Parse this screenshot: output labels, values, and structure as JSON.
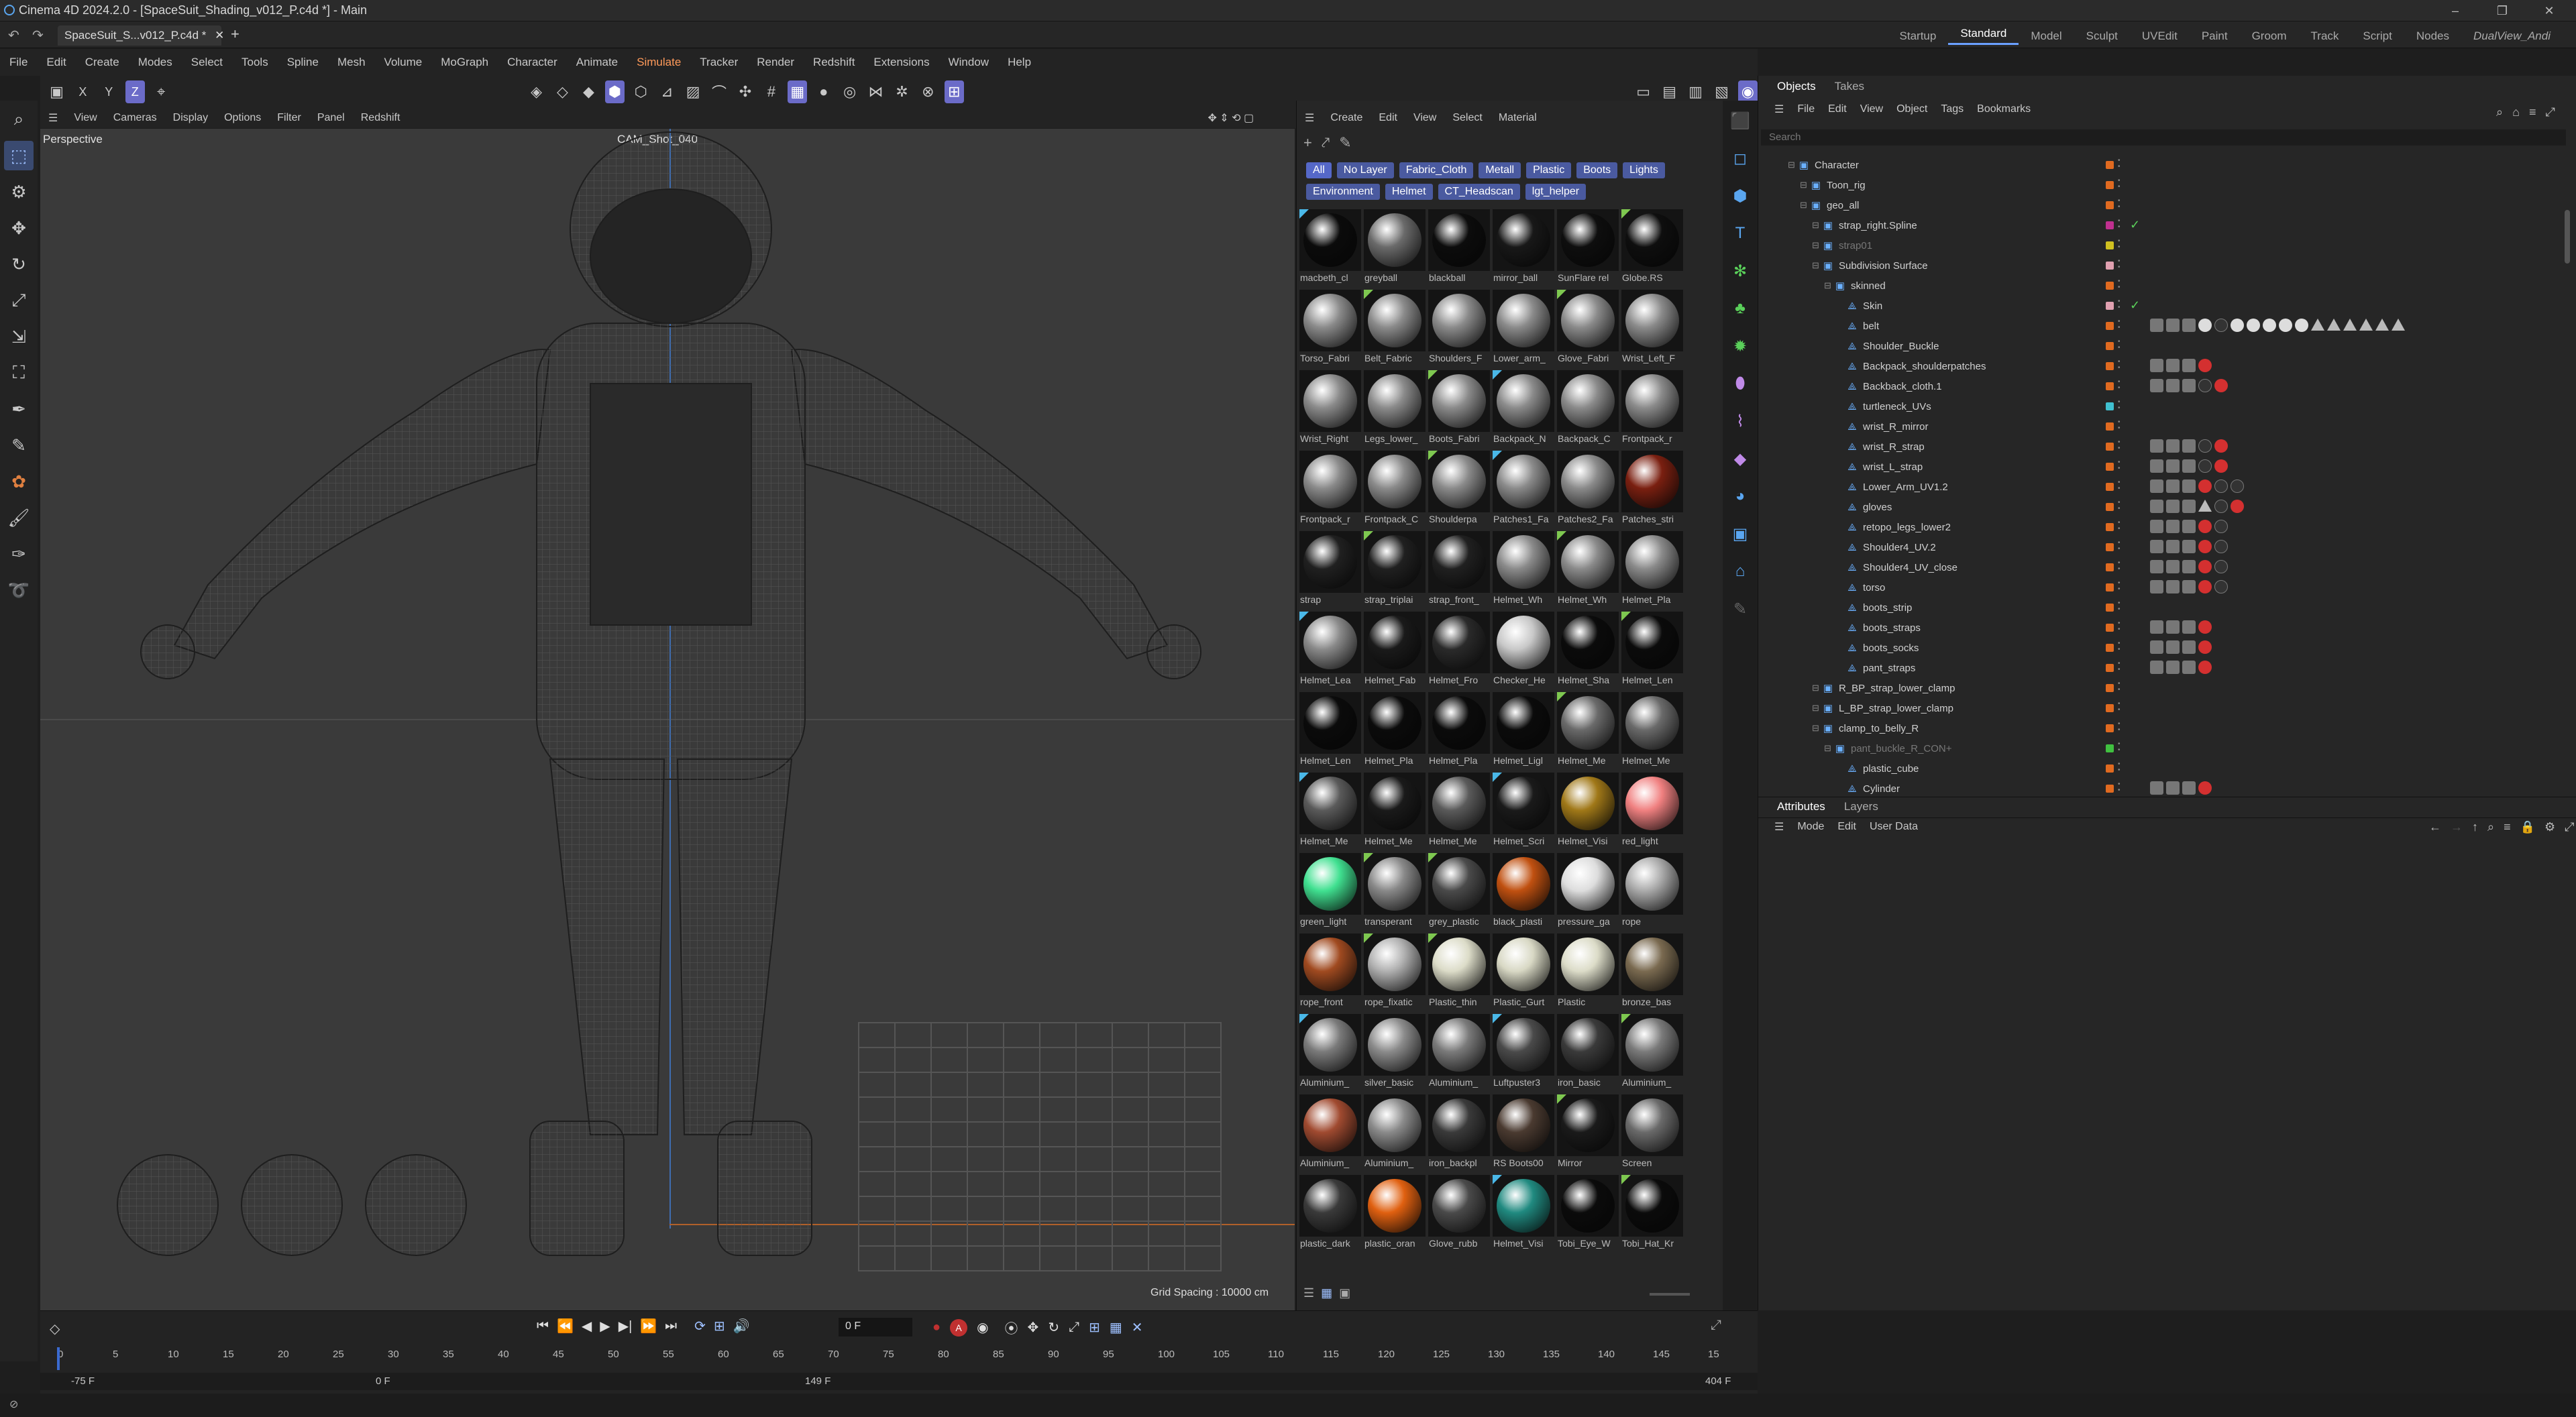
{
  "window": {
    "title": "Cinema 4D 2024.2.0 - [SpaceSuit_Shading_v012_P.c4d *] - Main",
    "doc_tab": "SpaceSuit_S...v012_P.c4d *"
  },
  "layouts": [
    "Startup",
    "Standard",
    "Model",
    "Sculpt",
    "UVEdit",
    "Paint",
    "Groom",
    "Track",
    "Script",
    "Nodes",
    "DualView_Andi"
  ],
  "menu": [
    "File",
    "Edit",
    "Create",
    "Modes",
    "Select",
    "Tools",
    "Spline",
    "Mesh",
    "Volume",
    "MoGraph",
    "Character",
    "Animate",
    "Simulate",
    "Tracker",
    "Render",
    "Redshift",
    "Extensions",
    "Window",
    "Help"
  ],
  "axis": {
    "x": "X",
    "y": "Y",
    "z": "Z"
  },
  "viewport": {
    "menu": [
      "View",
      "Cameras",
      "Display",
      "Options",
      "Filter",
      "Panel",
      "Redshift"
    ],
    "view_name": "Perspective",
    "camera": "CAM_Shot_040",
    "grid_spacing": "Grid Spacing : 10000 cm"
  },
  "materials": {
    "menu": [
      "Create",
      "Edit",
      "View",
      "Select",
      "Material"
    ],
    "filters": [
      "All",
      "No Layer",
      "Fabric_Cloth",
      "Metall",
      "Plastic",
      "Boots",
      "Lights",
      "Environment",
      "Helmet",
      "CT_Headscan",
      "lgt_helper"
    ],
    "items": [
      {
        "n": "macbeth_cl",
        "c": "#0b0b0b"
      },
      {
        "n": "greyball",
        "c": "#6a6a6a"
      },
      {
        "n": "blackball",
        "c": "#0c0c0c"
      },
      {
        "n": "mirror_ball",
        "c": "#181818"
      },
      {
        "n": "SunFlare rel",
        "c": "#0e0e0e"
      },
      {
        "n": "Globe.RS",
        "c": "#0e0e0e"
      },
      {
        "n": "Torso_Fabri",
        "c": "#8a8a8a"
      },
      {
        "n": "Belt_Fabric",
        "c": "#8a8a8a"
      },
      {
        "n": "Shoulders_F",
        "c": "#8a8a8a"
      },
      {
        "n": "Lower_arm_",
        "c": "#8a8a8a"
      },
      {
        "n": "Glove_Fabri",
        "c": "#8a8a8a"
      },
      {
        "n": "Wrist_Left_F",
        "c": "#8a8a8a"
      },
      {
        "n": "Wrist_Right",
        "c": "#8a8a8a"
      },
      {
        "n": "Legs_lower_",
        "c": "#8a8a8a"
      },
      {
        "n": "Boots_Fabri",
        "c": "#8a8a8a"
      },
      {
        "n": "Backpack_N",
        "c": "#8a8a8a"
      },
      {
        "n": "Backpack_C",
        "c": "#8a8a8a"
      },
      {
        "n": "Frontpack_r",
        "c": "#8a8a8a"
      },
      {
        "n": "Frontpack_r",
        "c": "#8a8a8a"
      },
      {
        "n": "Frontpack_C",
        "c": "#8a8a8a"
      },
      {
        "n": "Shoulderpa",
        "c": "#8a8a8a"
      },
      {
        "n": "Patches1_Fa",
        "c": "#8a8a8a"
      },
      {
        "n": "Patches2_Fa",
        "c": "#8a8a8a"
      },
      {
        "n": "Patches_stri",
        "c": "#7a1f10"
      },
      {
        "n": "strap",
        "c": "#202020"
      },
      {
        "n": "strap_triplai",
        "c": "#202020"
      },
      {
        "n": "strap_front_",
        "c": "#202020"
      },
      {
        "n": "Helmet_Wh",
        "c": "#8a8a8a"
      },
      {
        "n": "Helmet_Wh",
        "c": "#8a8a8a"
      },
      {
        "n": "Helmet_Pla",
        "c": "#8a8a8a"
      },
      {
        "n": "Helmet_Lea",
        "c": "#8a8a8a"
      },
      {
        "n": "Helmet_Fab",
        "c": "#1a1a1a"
      },
      {
        "n": "Helmet_Fro",
        "c": "#2a2a2a"
      },
      {
        "n": "Checker_He",
        "c": "#c8c8c8"
      },
      {
        "n": "Helmet_Sha",
        "c": "#0b0b0b"
      },
      {
        "n": "Helmet_Len",
        "c": "#0b0b0b"
      },
      {
        "n": "Helmet_Len",
        "c": "#0b0b0b"
      },
      {
        "n": "Helmet_Pla",
        "c": "#0b0b0b"
      },
      {
        "n": "Helmet_Pla",
        "c": "#0b0b0b"
      },
      {
        "n": "Helmet_Ligl",
        "c": "#0b0b0b"
      },
      {
        "n": "Helmet_Me",
        "c": "#6a6a6a"
      },
      {
        "n": "Helmet_Me",
        "c": "#6a6a6a"
      },
      {
        "n": "Helmet_Me",
        "c": "#5a5a5a"
      },
      {
        "n": "Helmet_Me",
        "c": "#1a1a1a"
      },
      {
        "n": "Helmet_Me",
        "c": "#5a5a5a"
      },
      {
        "n": "Helmet_Scri",
        "c": "#1a1a1a"
      },
      {
        "n": "Helmet_Visi",
        "c": "#a07818"
      },
      {
        "n": "red_light",
        "c": "#f08080"
      },
      {
        "n": "green_light",
        "c": "#40e090"
      },
      {
        "n": "transperant",
        "c": "#888888"
      },
      {
        "n": "grey_plastic",
        "c": "#4a4a4a"
      },
      {
        "n": "black_plasti",
        "c": "#c05010"
      },
      {
        "n": "pressure_ga",
        "c": "#dddddd"
      },
      {
        "n": "rope",
        "c": "#aaaaaa"
      },
      {
        "n": "rope_front",
        "c": "#a04a20"
      },
      {
        "n": "rope_fixatic",
        "c": "#b0b0b0"
      },
      {
        "n": "Plastic_thin",
        "c": "#dcdcc8"
      },
      {
        "n": "Plastic_Gurt",
        "c": "#d8d8c4"
      },
      {
        "n": "Plastic",
        "c": "#dcdcc8"
      },
      {
        "n": "bronze_bas",
        "c": "#7a6a50"
      },
      {
        "n": "Aluminium_",
        "c": "#7a7a7a"
      },
      {
        "n": "silver_basic",
        "c": "#8a8a8a"
      },
      {
        "n": "Aluminium_",
        "c": "#7a7a7a"
      },
      {
        "n": "Luftpuster3",
        "c": "#4a4a4a"
      },
      {
        "n": "iron_basic",
        "c": "#3a3a3a"
      },
      {
        "n": "Aluminium_",
        "c": "#7a7a7a"
      },
      {
        "n": "Aluminium_",
        "c": "#a04a30"
      },
      {
        "n": "Aluminium_",
        "c": "#8a8a8a"
      },
      {
        "n": "iron_backpl",
        "c": "#3a3a3a"
      },
      {
        "n": "RS Boots00",
        "c": "#4a3a30"
      },
      {
        "n": "Mirror",
        "c": "#1a1a1a"
      },
      {
        "n": "Screen",
        "c": "#6a6a6a"
      },
      {
        "n": "plastic_dark",
        "c": "#3a3a3a"
      },
      {
        "n": "plastic_oran",
        "c": "#e06010"
      },
      {
        "n": "Glove_rubb",
        "c": "#4a4a4a"
      },
      {
        "n": "Helmet_Visi",
        "c": "#208a80"
      },
      {
        "n": "Tobi_Eye_W",
        "c": "#0b0b0b"
      },
      {
        "n": "Tobi_Hat_Kr",
        "c": "#0b0b0b"
      }
    ]
  },
  "objects": {
    "tabs": [
      "Objects",
      "Takes"
    ],
    "menu": [
      "File",
      "Edit",
      "View",
      "Object",
      "Tags",
      "Bookmarks"
    ],
    "search_placeholder": "Search",
    "tree": [
      {
        "name": "Character",
        "d": 0,
        "lay": "#e06a20"
      },
      {
        "name": "Toon_rig",
        "d": 1,
        "lay": "#e06a20"
      },
      {
        "name": "geo_all",
        "d": 1,
        "lay": "#e06a20"
      },
      {
        "name": "strap_right.Spline",
        "d": 2,
        "lay": "#c03090",
        "ok": true
      },
      {
        "name": "strap01",
        "d": 2,
        "lay": "#d0c020",
        "dim": true
      },
      {
        "name": "Subdivision Surface",
        "d": 2,
        "lay": "#e0a0b0"
      },
      {
        "name": "skinned",
        "d": 3,
        "lay": "#e06a20"
      },
      {
        "name": "Skin",
        "d": 4,
        "lay": "#e0a0b0",
        "ok": true
      },
      {
        "name": "belt",
        "d": 4,
        "lay": "#e06a20",
        "tags": "wdwwwwwtttttt"
      },
      {
        "name": "Shoulder_Buckle",
        "d": 4,
        "lay": "#e06a20"
      },
      {
        "name": "Backpack_shoulderpatches",
        "d": 4,
        "lay": "#e06a20",
        "tags": "r"
      },
      {
        "name": "Backback_cloth.1",
        "d": 4,
        "lay": "#e06a20",
        "tags": "dr"
      },
      {
        "name": "turtleneck_UVs",
        "d": 4,
        "lay": "#40c0d0"
      },
      {
        "name": "wrist_R_mirror",
        "d": 4,
        "lay": "#e06a20"
      },
      {
        "name": "wrist_R_strap",
        "d": 4,
        "lay": "#e06a20",
        "tags": "dr"
      },
      {
        "name": "wrist_L_strap",
        "d": 4,
        "lay": "#e06a20",
        "tags": "dr"
      },
      {
        "name": "Lower_Arm_UV1.2",
        "d": 4,
        "lay": "#e06a20",
        "tags": "rdd"
      },
      {
        "name": "gloves",
        "d": 4,
        "lay": "#e06a20",
        "tags": "tdr"
      },
      {
        "name": "retopo_legs_lower2",
        "d": 4,
        "lay": "#e06a20",
        "tags": "rd"
      },
      {
        "name": "Shoulder4_UV.2",
        "d": 4,
        "lay": "#e06a20",
        "tags": "rd"
      },
      {
        "name": "Shoulder4_UV_close",
        "d": 4,
        "lay": "#e06a20",
        "tags": "rd"
      },
      {
        "name": "torso",
        "d": 4,
        "lay": "#e06a20",
        "tags": "rd"
      },
      {
        "name": "boots_strip",
        "d": 4,
        "lay": "#e06a20"
      },
      {
        "name": "boots_straps",
        "d": 4,
        "lay": "#e06a20",
        "tags": "r"
      },
      {
        "name": "boots_socks",
        "d": 4,
        "lay": "#e06a20",
        "tags": "r"
      },
      {
        "name": "pant_straps",
        "d": 4,
        "lay": "#e06a20",
        "tags": "r"
      },
      {
        "name": "R_BP_strap_lower_clamp",
        "d": 2,
        "lay": "#e06a20"
      },
      {
        "name": "L_BP_strap_lower_clamp",
        "d": 2,
        "lay": "#e06a20"
      },
      {
        "name": "clamp_to_belly_R",
        "d": 2,
        "lay": "#e06a20"
      },
      {
        "name": "pant_buckle_R_CON+",
        "d": 3,
        "lay": "#40c040",
        "dim": true
      },
      {
        "name": "plastic_cube",
        "d": 4,
        "lay": "#e06a20"
      },
      {
        "name": "Cylinder",
        "d": 4,
        "lay": "#e06a20",
        "tags": "r"
      }
    ]
  },
  "attributes": {
    "tabs": [
      "Attributes",
      "Layers"
    ],
    "menu": [
      "Mode",
      "Edit",
      "User Data"
    ]
  },
  "timeline": {
    "frame_field": "0 F",
    "start": "-75 F",
    "current": "0 F",
    "end_mark": "149 F",
    "end": "404 F",
    "ticks": [
      "0",
      "5",
      "10",
      "15",
      "20",
      "25",
      "30",
      "35",
      "40",
      "45",
      "50",
      "55",
      "60",
      "65",
      "70",
      "75",
      "80",
      "85",
      "90",
      "95",
      "100",
      "105",
      "110",
      "115",
      "120",
      "125",
      "130",
      "135",
      "140",
      "145",
      "15"
    ]
  }
}
